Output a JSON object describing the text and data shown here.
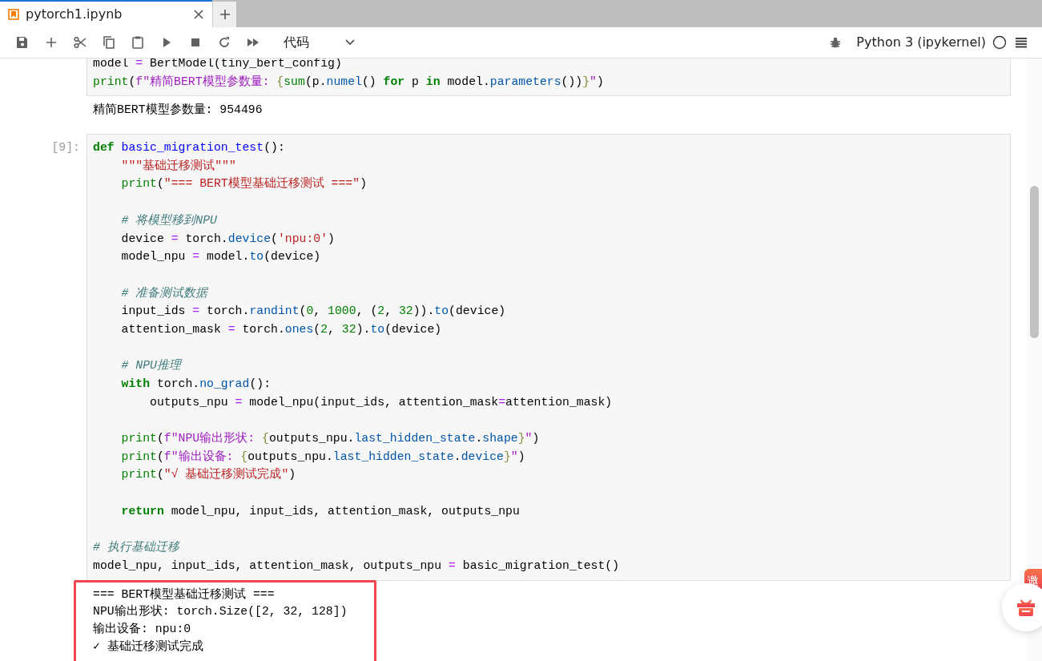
{
  "tabs": [
    {
      "title": "pytorch1.ipynb",
      "selected": true
    }
  ],
  "toolbar": {
    "cell_type": "代码",
    "kernel": "Python 3 (ipykernel)",
    "kernel_busy": false
  },
  "cells": [
    {
      "code": [
        {
          "kind": "code",
          "tokens": [
            {
              "text": "model ",
              "kind": "plain"
            },
            {
              "text": "=",
              "kind": "op"
            },
            {
              "text": " BertModel(tiny_bert_config)",
              "kind": "plain"
            }
          ]
        },
        {
          "kind": "code",
          "tokens": [
            {
              "text": "print",
              "kind": "bi"
            },
            {
              "text": "(",
              "kind": "plain"
            },
            {
              "text": "f\"精简BERT模型参数量: ",
              "kind": "fstr"
            },
            {
              "text": "{",
              "kind": "brace"
            },
            {
              "text": "sum",
              "kind": "bi"
            },
            {
              "text": "(p.",
              "kind": "plain"
            },
            {
              "text": "numel",
              "kind": "prop"
            },
            {
              "text": "() ",
              "kind": "plain"
            },
            {
              "text": "for",
              "kind": "kw"
            },
            {
              "text": " p ",
              "kind": "plain"
            },
            {
              "text": "in",
              "kind": "kw"
            },
            {
              "text": " model.",
              "kind": "plain"
            },
            {
              "text": "parameters",
              "kind": "prop"
            },
            {
              "text": "())",
              "kind": "plain"
            },
            {
              "text": "}",
              "kind": "brace"
            },
            {
              "text": "\"",
              "kind": "fstr"
            },
            {
              "text": ")",
              "kind": "plain"
            }
          ]
        }
      ],
      "output": [
        "精简BERT模型参数量: 954496"
      ],
      "highlighted": false
    },
    {
      "prompt": "[9]:",
      "code": [
        {
          "kind": "code",
          "tokens": [
            {
              "text": "def",
              "kind": "kw"
            },
            {
              "text": " basic_migration_test",
              "kind": "fn"
            },
            {
              "text": "():",
              "kind": "plain"
            }
          ]
        },
        {
          "kind": "code",
          "tokens": [
            {
              "text": "    \"\"\"基础迁移测试\"\"\"",
              "kind": "str"
            }
          ]
        },
        {
          "kind": "code",
          "tokens": [
            {
              "text": "    print",
              "kind": "bi"
            },
            {
              "text": "(",
              "kind": "plain"
            },
            {
              "text": "\"=== BERT模型基础迁移测试 ===\"",
              "kind": "str"
            },
            {
              "text": ")",
              "kind": "plain"
            }
          ]
        },
        {
          "kind": "blank"
        },
        {
          "kind": "code",
          "tokens": [
            {
              "text": "    # 将模型移到NPU",
              "kind": "com"
            }
          ]
        },
        {
          "kind": "code",
          "tokens": [
            {
              "text": "    device ",
              "kind": "plain"
            },
            {
              "text": "=",
              "kind": "op"
            },
            {
              "text": " torch.",
              "kind": "plain"
            },
            {
              "text": "device",
              "kind": "prop"
            },
            {
              "text": "(",
              "kind": "plain"
            },
            {
              "text": "'npu:0'",
              "kind": "str"
            },
            {
              "text": ")",
              "kind": "plain"
            }
          ]
        },
        {
          "kind": "code",
          "tokens": [
            {
              "text": "    model_npu ",
              "kind": "plain"
            },
            {
              "text": "=",
              "kind": "op"
            },
            {
              "text": " model.",
              "kind": "plain"
            },
            {
              "text": "to",
              "kind": "prop"
            },
            {
              "text": "(device)",
              "kind": "plain"
            }
          ]
        },
        {
          "kind": "blank"
        },
        {
          "kind": "code",
          "tokens": [
            {
              "text": "    # 准备测试数据",
              "kind": "com"
            }
          ]
        },
        {
          "kind": "code",
          "tokens": [
            {
              "text": "    input_ids ",
              "kind": "plain"
            },
            {
              "text": "=",
              "kind": "op"
            },
            {
              "text": " torch.",
              "kind": "plain"
            },
            {
              "text": "randint",
              "kind": "prop"
            },
            {
              "text": "(",
              "kind": "plain"
            },
            {
              "text": "0",
              "kind": "num"
            },
            {
              "text": ", ",
              "kind": "plain"
            },
            {
              "text": "1000",
              "kind": "num"
            },
            {
              "text": ", (",
              "kind": "plain"
            },
            {
              "text": "2",
              "kind": "num"
            },
            {
              "text": ", ",
              "kind": "plain"
            },
            {
              "text": "32",
              "kind": "num"
            },
            {
              "text": ")).",
              "kind": "plain"
            },
            {
              "text": "to",
              "kind": "prop"
            },
            {
              "text": "(device)",
              "kind": "plain"
            }
          ]
        },
        {
          "kind": "code",
          "tokens": [
            {
              "text": "    attention_mask ",
              "kind": "plain"
            },
            {
              "text": "=",
              "kind": "op"
            },
            {
              "text": " torch.",
              "kind": "plain"
            },
            {
              "text": "ones",
              "kind": "prop"
            },
            {
              "text": "(",
              "kind": "plain"
            },
            {
              "text": "2",
              "kind": "num"
            },
            {
              "text": ", ",
              "kind": "plain"
            },
            {
              "text": "32",
              "kind": "num"
            },
            {
              "text": ").",
              "kind": "plain"
            },
            {
              "text": "to",
              "kind": "prop"
            },
            {
              "text": "(device)",
              "kind": "plain"
            }
          ]
        },
        {
          "kind": "blank"
        },
        {
          "kind": "code",
          "tokens": [
            {
              "text": "    # NPU推理",
              "kind": "com"
            }
          ]
        },
        {
          "kind": "code",
          "tokens": [
            {
              "text": "    with",
              "kind": "kw"
            },
            {
              "text": " torch.",
              "kind": "plain"
            },
            {
              "text": "no_grad",
              "kind": "prop"
            },
            {
              "text": "():",
              "kind": "plain"
            }
          ]
        },
        {
          "kind": "code",
          "tokens": [
            {
              "text": "        outputs_npu ",
              "kind": "plain"
            },
            {
              "text": "=",
              "kind": "op"
            },
            {
              "text": " model_npu(input_ids, attention_mask",
              "kind": "plain"
            },
            {
              "text": "=",
              "kind": "op"
            },
            {
              "text": "attention_mask)",
              "kind": "plain"
            }
          ]
        },
        {
          "kind": "blank"
        },
        {
          "kind": "code",
          "tokens": [
            {
              "text": "    print",
              "kind": "bi"
            },
            {
              "text": "(",
              "kind": "plain"
            },
            {
              "text": "f\"NPU输出形状: ",
              "kind": "fstr"
            },
            {
              "text": "{",
              "kind": "brace"
            },
            {
              "text": "outputs_npu.",
              "kind": "plain"
            },
            {
              "text": "last_hidden_state",
              "kind": "prop"
            },
            {
              "text": ".",
              "kind": "plain"
            },
            {
              "text": "shape",
              "kind": "prop"
            },
            {
              "text": "}",
              "kind": "brace"
            },
            {
              "text": "\"",
              "kind": "fstr"
            },
            {
              "text": ")",
              "kind": "plain"
            }
          ]
        },
        {
          "kind": "code",
          "tokens": [
            {
              "text": "    print",
              "kind": "bi"
            },
            {
              "text": "(",
              "kind": "plain"
            },
            {
              "text": "f\"输出设备: ",
              "kind": "fstr"
            },
            {
              "text": "{",
              "kind": "brace"
            },
            {
              "text": "outputs_npu.",
              "kind": "plain"
            },
            {
              "text": "last_hidden_state",
              "kind": "prop"
            },
            {
              "text": ".",
              "kind": "plain"
            },
            {
              "text": "device",
              "kind": "prop"
            },
            {
              "text": "}",
              "kind": "brace"
            },
            {
              "text": "\"",
              "kind": "fstr"
            },
            {
              "text": ")",
              "kind": "plain"
            }
          ]
        },
        {
          "kind": "code",
          "tokens": [
            {
              "text": "    print",
              "kind": "bi"
            },
            {
              "text": "(",
              "kind": "plain"
            },
            {
              "text": "\"√ 基础迁移测试完成\"",
              "kind": "str"
            },
            {
              "text": ")",
              "kind": "plain"
            }
          ]
        },
        {
          "kind": "blank"
        },
        {
          "kind": "code",
          "tokens": [
            {
              "text": "    return",
              "kind": "kw"
            },
            {
              "text": " model_npu, input_ids, attention_mask, outputs_npu",
              "kind": "plain"
            }
          ]
        },
        {
          "kind": "blank"
        },
        {
          "kind": "code",
          "tokens": [
            {
              "text": "# 执行基础迁移",
              "kind": "com"
            }
          ]
        },
        {
          "kind": "code",
          "tokens": [
            {
              "text": "model_npu, input_ids, attention_mask, outputs_npu ",
              "kind": "plain"
            },
            {
              "text": "=",
              "kind": "op"
            },
            {
              "text": " basic_migration_test()",
              "kind": "plain"
            }
          ]
        }
      ],
      "output": [
        "=== BERT模型基础迁移测试 ===",
        "NPU输出形状: torch.Size([2, 32, 128])",
        "输出设备: npu:0",
        "✓ 基础迁移测试完成"
      ],
      "highlighted": true
    }
  ],
  "invite_badge": "邀"
}
